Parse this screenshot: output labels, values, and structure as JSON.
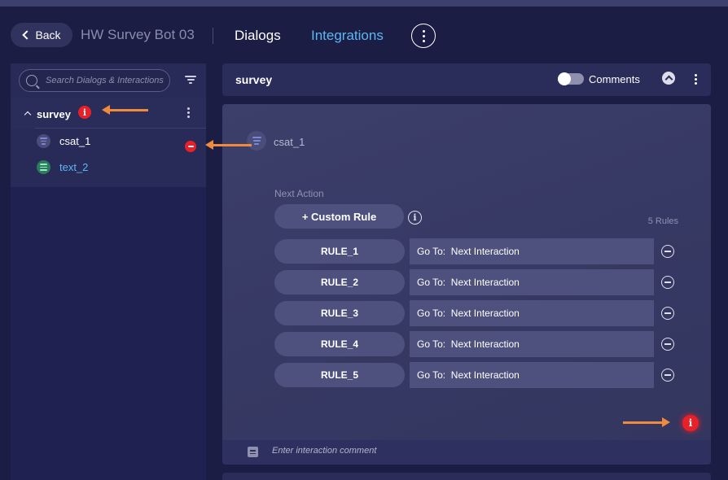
{
  "header": {
    "back_label": "Back",
    "bot_name": "HW Survey Bot 03",
    "tabs": [
      {
        "label": "Dialogs",
        "active": true
      },
      {
        "label": "Integrations",
        "active": false
      }
    ]
  },
  "sidebar": {
    "search_placeholder": "Search Dialogs & Interactions",
    "group": {
      "name": "survey",
      "error_badge": "i"
    },
    "items": [
      {
        "label": "csat_1",
        "icon": "csat-icon",
        "color": "#ffffff"
      },
      {
        "label": "text_2",
        "icon": "text-icon",
        "color": "#5bb8f0"
      }
    ]
  },
  "main": {
    "title": "survey",
    "comments_label": "Comments",
    "node_name": "csat_1",
    "next_action_label": "Next Action",
    "custom_rule_label": "+ Custom Rule",
    "info_badge": "i",
    "rules_count": "5 Rules",
    "rules": [
      {
        "name": "RULE_1",
        "goto": "Go To:  Next Interaction"
      },
      {
        "name": "RULE_2",
        "goto": "Go To:  Next Interaction"
      },
      {
        "name": "RULE_3",
        "goto": "Go To:  Next Interaction"
      },
      {
        "name": "RULE_4",
        "goto": "Go To:  Next Interaction"
      },
      {
        "name": "RULE_5",
        "goto": "Go To:  Next Interaction"
      }
    ],
    "error_badge": "i",
    "comment_placeholder": "Enter interaction comment"
  },
  "colors": {
    "background": "#1c1d44",
    "accent": "#5bb8f0",
    "error": "#e8202a",
    "annotation_arrow": "#f08a3c"
  }
}
